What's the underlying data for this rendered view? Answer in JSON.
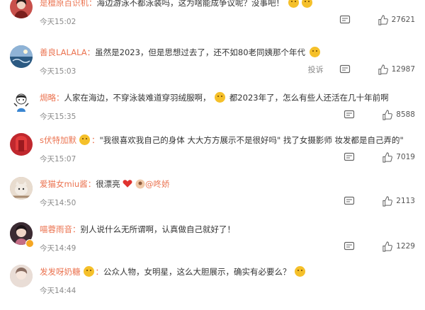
{
  "comments": [
    {
      "username": "是檀原百识机",
      "text": "海边游泳不都泳装吗，这为啥能成争议呢？没事吧！",
      "time": "今天15:02",
      "likes": "27621",
      "avatar_color": "#c8504b"
    },
    {
      "username": "善良LALALA",
      "text": "虽然是2023，但是思想过去了，还不如80老同姨那个年代",
      "time": "今天15:03",
      "report": "投诉",
      "likes": "12987",
      "avatar_color": "#3a6fa3"
    },
    {
      "username": "焗略",
      "text": "人家在海边，不穿泳装难道穿羽绒服啊，",
      "text2": "都2023年了，怎么有些人还活在几十年前啊",
      "time": "今天15:35",
      "likes": "8588",
      "avatar_color": "#ffffff"
    },
    {
      "username": "s伏特加默",
      "text": "\"我很喜欢我自己的身体 大大方方展示不是很好吗\" 找了女摄影师 妆发都是自己弄的\"",
      "time": "今天15:07",
      "likes": "7019",
      "avatar_color": "#c0282e"
    },
    {
      "username": "爱猫女miu酱",
      "text": "很漂亮",
      "mention": "@咚娇",
      "time": "今天14:50",
      "likes": "2113",
      "avatar_color": "#caa98d"
    },
    {
      "username": "喵蓉雨音",
      "text": "别人说什么无所谓啊，认真做自己就好了！",
      "time": "今天14:49",
      "likes": "1229",
      "avatar_color": "#6a4a52"
    },
    {
      "username": "发发呀奶糖",
      "text": "公众人物，女明星，这么大胆展示，确实有必要么？",
      "time": "今天14:44",
      "avatar_color": "#d9c6bd"
    }
  ]
}
